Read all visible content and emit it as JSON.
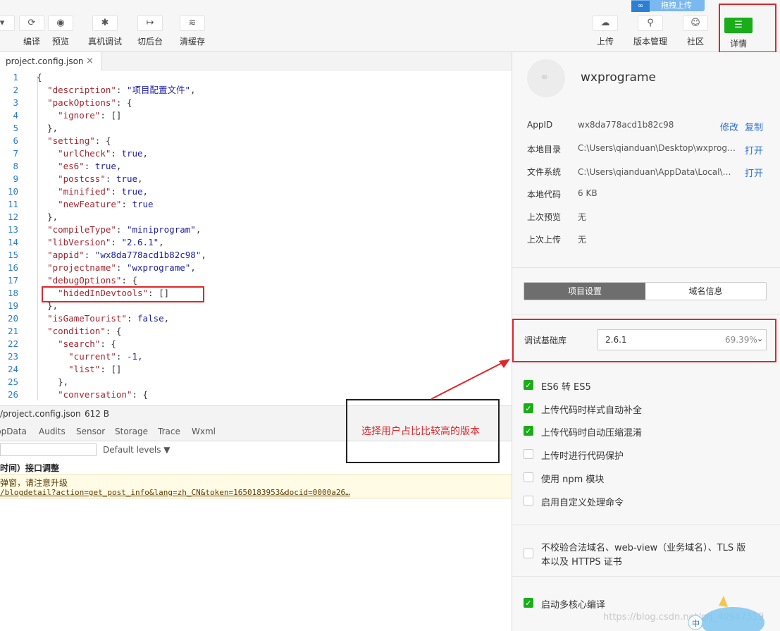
{
  "toolbar": {
    "left_items": [
      {
        "label": "编译",
        "icon": "refresh-icon",
        "glyph": "⟳"
      },
      {
        "label": "预览",
        "icon": "eye-icon",
        "glyph": "◉"
      },
      {
        "label": "真机调试",
        "icon": "bug-icon",
        "glyph": "✱"
      },
      {
        "label": "切后台",
        "icon": "switch-background-icon",
        "glyph": "↦"
      },
      {
        "label": "清缓存",
        "icon": "layers-icon",
        "glyph": "≋"
      }
    ],
    "right_items": [
      {
        "label": "上传",
        "icon": "cloud-upload-icon",
        "glyph": "☁"
      },
      {
        "label": "版本管理",
        "icon": "version-icon",
        "glyph": "⚲"
      },
      {
        "label": "社区",
        "icon": "community-icon",
        "glyph": "☺"
      }
    ],
    "detail_label": "详情",
    "detail_glyph": "☰",
    "upload_tip": "拖拽上传"
  },
  "editor": {
    "tab_name": "project.config.json",
    "close_glyph": "×",
    "lines": [
      {
        "n": "1",
        "t": "{"
      },
      {
        "n": "2",
        "t": "  \"description\": \"项目配置文件\","
      },
      {
        "n": "3",
        "t": "  \"packOptions\": {"
      },
      {
        "n": "4",
        "t": "    \"ignore\": []"
      },
      {
        "n": "5",
        "t": "  },"
      },
      {
        "n": "6",
        "t": "  \"setting\": {"
      },
      {
        "n": "7",
        "t": "    \"urlCheck\": true,"
      },
      {
        "n": "8",
        "t": "    \"es6\": true,"
      },
      {
        "n": "9",
        "t": "    \"postcss\": true,"
      },
      {
        "n": "10",
        "t": "    \"minified\": true,"
      },
      {
        "n": "11",
        "t": "    \"newFeature\": true"
      },
      {
        "n": "12",
        "t": "  },"
      },
      {
        "n": "13",
        "t": "  \"compileType\": \"miniprogram\","
      },
      {
        "n": "14",
        "t": "  \"libVersion\": \"2.6.1\","
      },
      {
        "n": "15",
        "t": "  \"appid\": \"wx8da778acd1b82c98\","
      },
      {
        "n": "16",
        "t": "  \"projectname\": \"wxprograme\","
      },
      {
        "n": "17",
        "t": "  \"debugOptions\": {"
      },
      {
        "n": "18",
        "t": "    \"hidedInDevtools\": []"
      },
      {
        "n": "19",
        "t": "  },"
      },
      {
        "n": "20",
        "t": "  \"isGameTourist\": false,"
      },
      {
        "n": "21",
        "t": "  \"condition\": {"
      },
      {
        "n": "22",
        "t": "    \"search\": {"
      },
      {
        "n": "23",
        "t": "      \"current\": -1,"
      },
      {
        "n": "24",
        "t": "      \"list\": []"
      },
      {
        "n": "25",
        "t": "    },"
      },
      {
        "n": "26",
        "t": "    \"conversation\": {"
      }
    ]
  },
  "status": {
    "path": "/project.config.json",
    "size": "612 B"
  },
  "debug": {
    "tabs": [
      "ppData",
      "Audits",
      "Sensor",
      "Storage",
      "Trace",
      "Wxml"
    ],
    "levels": "Default levels ▼",
    "line1": "时间）接口调整",
    "warn1": "弹窗，请注意升级",
    "warn2": "/blogdetail?action=get_post_info&lang=zh_CN&token=1650183953&docid=0000a26…"
  },
  "annotation": {
    "text": "选择用户占比比较高的版本"
  },
  "panel": {
    "app_name": "wxprograme",
    "avatar_glyph": "⚭",
    "info": [
      {
        "key": "AppID",
        "value": "wx8da778acd1b82c98",
        "actions": [
          "修改",
          "复制"
        ]
      },
      {
        "key": "本地目录",
        "value": "C:\\Users\\qianduan\\Desktop\\wxprograme",
        "actions": [
          "打开"
        ]
      },
      {
        "key": "文件系统",
        "value": "C:\\Users\\qianduan\\AppData\\Local\\微信…",
        "actions": [
          "打开"
        ]
      },
      {
        "key": "本地代码",
        "value": "6 KB",
        "actions": []
      },
      {
        "key": "上次预览",
        "value": "无",
        "actions": []
      },
      {
        "key": "上次上传",
        "value": "无",
        "actions": []
      }
    ],
    "seg_active": "项目设置",
    "seg_other": "域名信息",
    "lib_label": "调试基础库",
    "lib_version": "2.6.1",
    "lib_percent": "69.39%",
    "lib_chevron": "⌄",
    "checkboxes": [
      {
        "label": "ES6 转 ES5",
        "checked": true
      },
      {
        "label": "上传代码时样式自动补全",
        "checked": true
      },
      {
        "label": "上传代码时自动压缩混淆",
        "checked": true
      },
      {
        "label": "上传时进行代码保护",
        "checked": false
      },
      {
        "label": "使用 npm 模块",
        "checked": false
      },
      {
        "label": "启用自定义处理命令",
        "checked": false
      }
    ],
    "domain_check_line1": "不校验合法域名、web-view（业务域名）、TLS 版",
    "domain_check_line2": "本以及 HTTPS 证书",
    "multicore": "启动多核心编译",
    "check_glyph": "✓"
  },
  "watermark": "https://blog.csdn.net/qq_40947519",
  "colors": {
    "accent_green": "#1aad19",
    "highlight_red": "#e0262b",
    "link_blue": "#2b6fd6"
  }
}
